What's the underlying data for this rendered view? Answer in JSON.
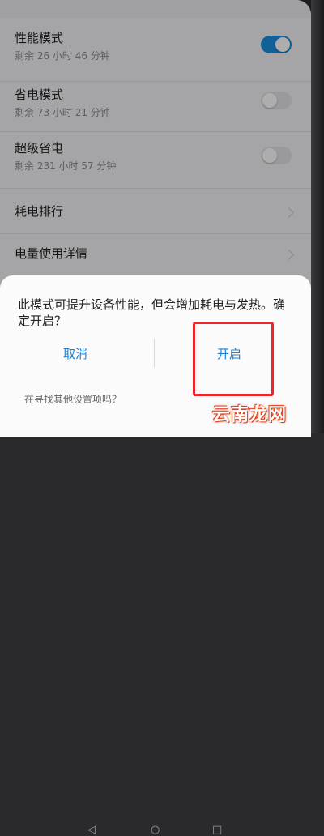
{
  "header": {
    "title": ""
  },
  "modes": [
    {
      "title": "性能模式",
      "remaining": "剩余 26 小时 46 分钟",
      "toggle": "on"
    },
    {
      "title": "省电模式",
      "remaining": "剩余 73 小时 21 分钟",
      "toggle": "off"
    },
    {
      "title": "超级省电",
      "remaining": "剩余 231 小时 57 分钟",
      "toggle": "off"
    }
  ],
  "links": [
    {
      "label": "耗电排行"
    },
    {
      "label": "电量使用详情"
    }
  ],
  "dialog": {
    "message": "此模式可提升设备性能，但会增加耗电与发热。确定开启？",
    "cancel_label": "取消",
    "confirm_label": "开启"
  },
  "footer": {
    "hint": "在寻找其他设置项吗？"
  },
  "watermark": "云南龙网",
  "colors": {
    "accent": "#1a8fe0",
    "highlight": "#f0252a",
    "watermark": "#e0431c"
  }
}
